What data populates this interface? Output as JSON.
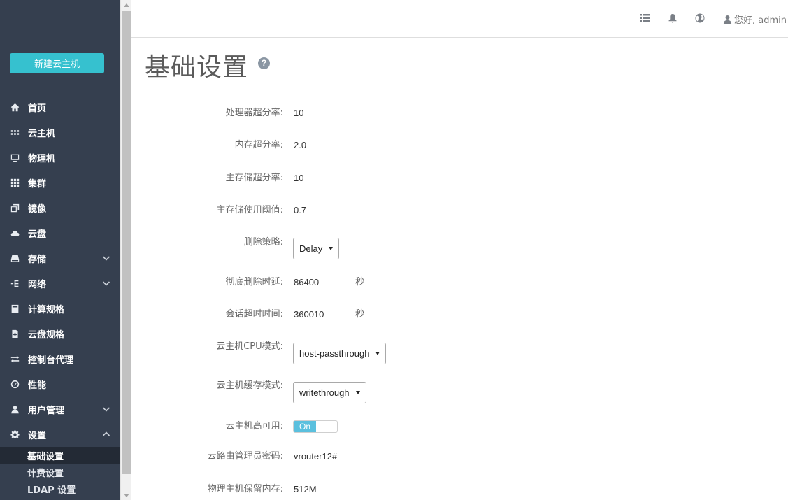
{
  "sidebar": {
    "new_button": "新建云主机",
    "items": [
      {
        "label": "首页",
        "icon": "home-icon"
      },
      {
        "label": "云主机",
        "icon": "grid-small-icon"
      },
      {
        "label": "物理机",
        "icon": "monitor-icon"
      },
      {
        "label": "集群",
        "icon": "grid-icon"
      },
      {
        "label": "镜像",
        "icon": "copy-icon"
      },
      {
        "label": "云盘",
        "icon": "cloud-icon"
      },
      {
        "label": "存储",
        "icon": "hdd-icon"
      },
      {
        "label": "网络",
        "icon": "network-icon"
      },
      {
        "label": "计算规格",
        "icon": "calculator-icon"
      },
      {
        "label": "云盘规格",
        "icon": "file-plus-icon"
      },
      {
        "label": "控制台代理",
        "icon": "transfer-icon"
      },
      {
        "label": "性能",
        "icon": "dashboard-icon"
      },
      {
        "label": "用户管理",
        "icon": "user-icon"
      },
      {
        "label": "设置",
        "icon": "gear-icon"
      }
    ],
    "sub_items": [
      "基础设置",
      "计费设置",
      "LDAP 设置"
    ]
  },
  "header": {
    "greeting": "您好, admin"
  },
  "main": {
    "title": "基础设置",
    "fields": {
      "cpu_overcommit": {
        "label": "处理器超分率:",
        "value": "10"
      },
      "mem_overcommit": {
        "label": "内存超分率:",
        "value": "2.0"
      },
      "storage_overcommit": {
        "label": "主存储超分率:",
        "value": "10"
      },
      "storage_threshold": {
        "label": "主存储使用阈值:",
        "value": "0.7"
      },
      "delete_policy": {
        "label": "删除策略:",
        "value": "Delay"
      },
      "expunge_delay": {
        "label": "彻底删除时延:",
        "value": "86400",
        "unit": "秒"
      },
      "session_timeout": {
        "label": "会话超时时间:",
        "value": "360010",
        "unit": "秒"
      },
      "cpu_mode": {
        "label": "云主机CPU模式:",
        "value": "host-passthrough"
      },
      "cache_mode": {
        "label": "云主机缓存模式:",
        "value": "writethrough"
      },
      "ha": {
        "label": "云主机高可用:",
        "value": "On"
      },
      "vrouter_password": {
        "label": "云路由管理员密码:",
        "value": "vrouter12#"
      },
      "reserved_memory": {
        "label": "物理主机保留内存:",
        "value": "512M"
      }
    }
  },
  "colors": {
    "sidebar_bg": "#353f4f",
    "accent": "#36c1cf",
    "toggle_on": "#5bc0de"
  }
}
